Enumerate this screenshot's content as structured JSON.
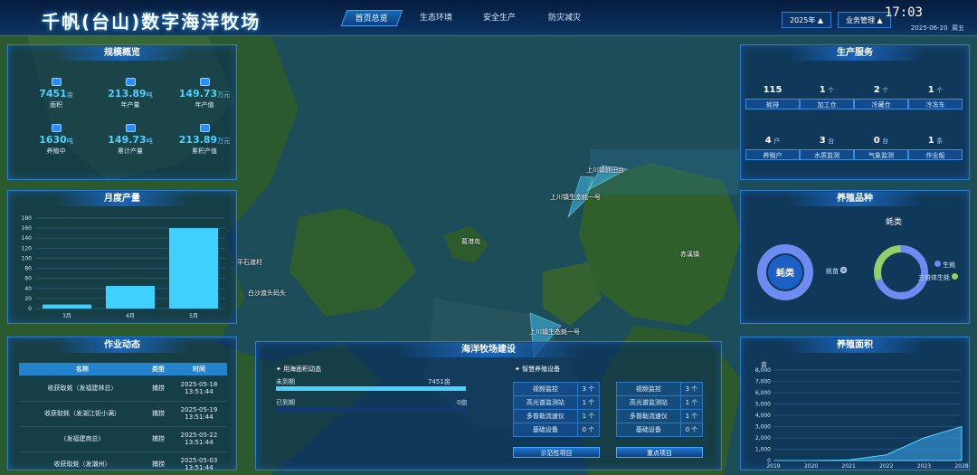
{
  "app_title": "千帆(台山)数字海洋牧场",
  "nav": [
    {
      "label": "首页总览",
      "active": true
    },
    {
      "label": "生态环境"
    },
    {
      "label": "安全生产"
    },
    {
      "label": "防灾减灾"
    }
  ],
  "year_select": "2025年",
  "biz_select": "业务管理",
  "clock": {
    "time": "17:03",
    "date": "2025-06-20",
    "weekday": "周五"
  },
  "scale": {
    "title": "规模概览",
    "items": [
      {
        "value": "7451",
        "unit": "亩",
        "label": "面积",
        "icon": "area-icon"
      },
      {
        "value": "213.89",
        "unit": "吨",
        "label": "年产量",
        "icon": "output-icon"
      },
      {
        "value": "149.73",
        "unit": "万元",
        "label": "年产值",
        "icon": "value-icon"
      },
      {
        "value": "1630",
        "unit": "吨",
        "label": "养殖中",
        "icon": "farming-icon"
      },
      {
        "value": "149.73",
        "unit": "吨",
        "label": "累计产量",
        "icon": "total-output-icon"
      },
      {
        "value": "213.89",
        "unit": "万元",
        "label": "累积产值",
        "icon": "total-value-icon"
      }
    ]
  },
  "monthly": {
    "title": "月度产量"
  },
  "chart_data": [
    {
      "type": "bar",
      "title": "月度产量",
      "categories": [
        "3月",
        "4月",
        "5月"
      ],
      "values": [
        8,
        45,
        160
      ],
      "ylim": [
        0,
        180
      ],
      "yticks": [
        0,
        20,
        40,
        60,
        80,
        100,
        120,
        140,
        160,
        180
      ],
      "grid": true
    },
    {
      "type": "pie",
      "title": "蚝类",
      "center_label": "蚝类",
      "slices": [
        {
          "name": "蚝苗",
          "value": 100
        }
      ]
    },
    {
      "type": "pie",
      "title": "蚝类",
      "slices": [
        {
          "name": "生蚝",
          "value": 70
        },
        {
          "name": "三倍体生蚝",
          "value": 30
        }
      ]
    },
    {
      "type": "area",
      "title": "养殖面积",
      "ylabel": "亩",
      "x": [
        2019,
        2020,
        2021,
        2022,
        2023,
        2028
      ],
      "yticks": [
        0,
        1000,
        2000,
        3000,
        4000,
        5000,
        6000,
        7000,
        8000
      ],
      "ylim": [
        0,
        8000
      ],
      "points": [
        [
          2019,
          0
        ],
        [
          2020,
          0
        ],
        [
          2021,
          50
        ],
        [
          2022,
          500
        ],
        [
          2023,
          2000
        ],
        [
          2028,
          3000
        ]
      ]
    }
  ],
  "ops": {
    "title": "作业动态",
    "headers": [
      "名称",
      "类型",
      "时间"
    ],
    "rows": [
      {
        "name": "收获取蚝（发福建林总）",
        "type": "捕捞",
        "time": "2025-05-18\n13:51:44"
      },
      {
        "name": "收获取蚝（发湖江钜小满）",
        "type": "捕捞",
        "time": "2025-05-19\n13:51:44"
      },
      {
        "name": "(发福建商总)",
        "type": "捕捞",
        "time": "2025-05-22\n13:51:44"
      },
      {
        "name": "收获取蚝（发潮州）",
        "type": "捕捞",
        "time": "2025-05-03\n13:51:44"
      }
    ]
  },
  "build": {
    "title": "海洋牧场建设",
    "sea_title": "用海面积动态",
    "sea": [
      {
        "label": "未到期",
        "value": "7451亩",
        "fraction": 1
      },
      {
        "label": "已到期",
        "value": "0亩",
        "fraction": 0
      }
    ],
    "equip_title": "智慧养殖设备",
    "equip_left": [
      {
        "name": "视频监控",
        "count": "3 个"
      },
      {
        "name": "高光谱监测站",
        "count": "1 个"
      },
      {
        "name": "多普勒流速仪",
        "count": "1 个"
      },
      {
        "name": "基础设备",
        "count": "0 个"
      }
    ],
    "equip_right": [
      {
        "name": "视频监控",
        "count": "3 个"
      },
      {
        "name": "高光谱监测站",
        "count": "1 个"
      },
      {
        "name": "多普勒流速仪",
        "count": "1 个"
      },
      {
        "name": "基础设备",
        "count": "0 个"
      }
    ],
    "btn_demo": "示范性项目",
    "btn_key": "重点项目"
  },
  "service": {
    "title": "生产服务",
    "items": [
      {
        "value": "115",
        "unit": "",
        "label": "蚝排"
      },
      {
        "value": "1",
        "unit": "个",
        "label": "加工仓"
      },
      {
        "value": "2",
        "unit": "个",
        "label": "冷藏仓"
      },
      {
        "value": "1",
        "unit": "个",
        "label": "冷冻车"
      },
      {
        "value": "4",
        "unit": "户",
        "label": "养殖户"
      },
      {
        "value": "3",
        "unit": "台",
        "label": "水质监测"
      },
      {
        "value": "0",
        "unit": "台",
        "label": "气象监测"
      },
      {
        "value": "1",
        "unit": "条",
        "label": "作业船"
      }
    ]
  },
  "species": {
    "title": "养殖品种",
    "sub": "蚝类",
    "legend1": "蚝苗",
    "legend2a": "生蚝",
    "legend2b": "三倍体生蚝"
  },
  "area_panel": {
    "title": "养殖面积"
  },
  "map_labels": [
    "上川镇蚝田台",
    "上川镇生态蚝一号",
    "葛港岛",
    "上川镇生态蚝一号",
    "平石渡村",
    "白沙渡头码头",
    "赤溪镇"
  ]
}
